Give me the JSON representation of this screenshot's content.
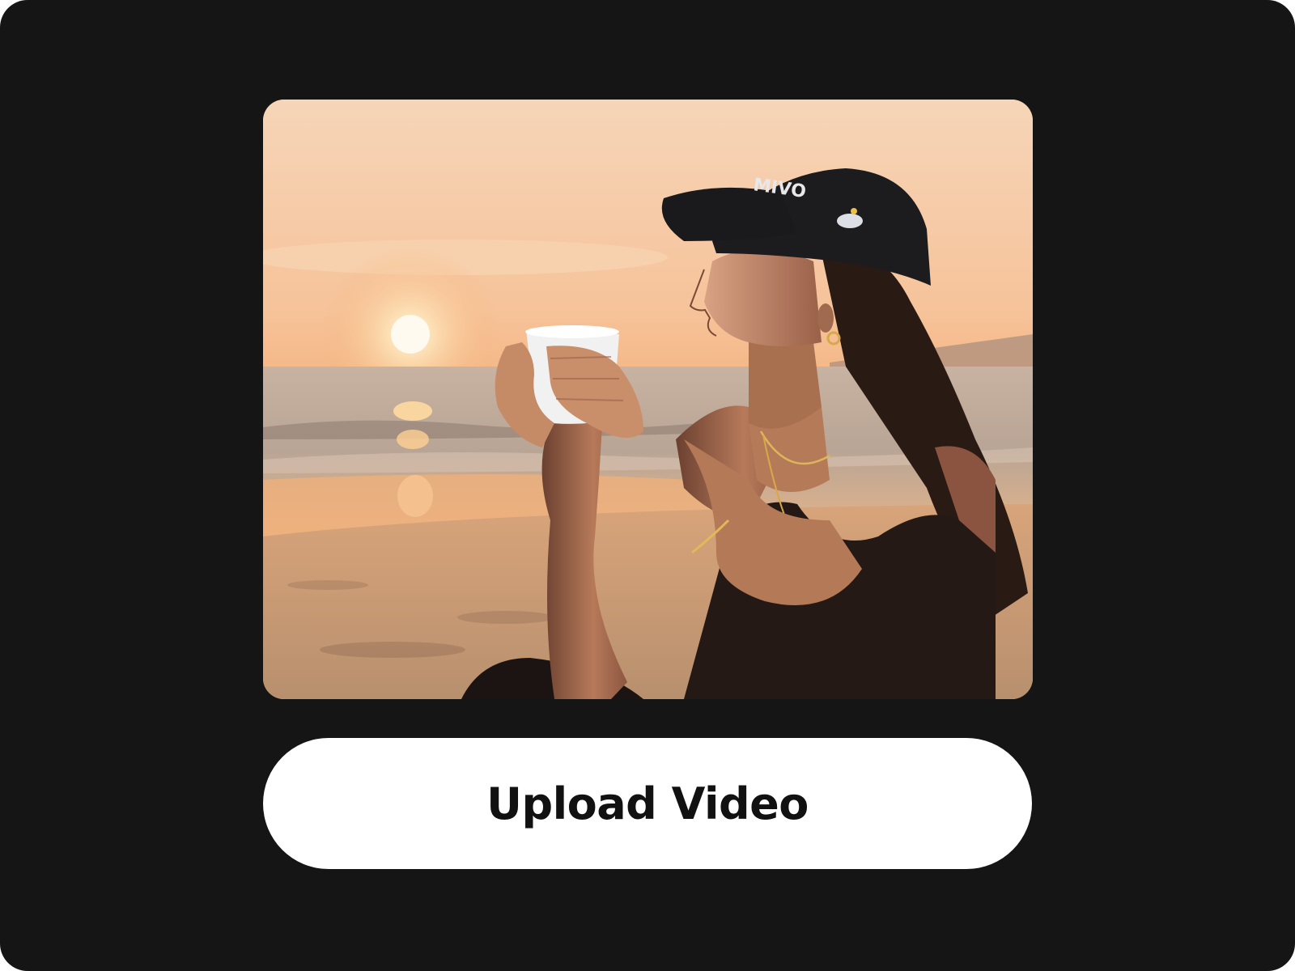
{
  "preview": {
    "cap_text": "MIVO"
  },
  "actions": {
    "upload_label": "Upload Video"
  },
  "colors": {
    "background": "#151515",
    "button_bg": "#ffffff",
    "button_text": "#111111"
  }
}
